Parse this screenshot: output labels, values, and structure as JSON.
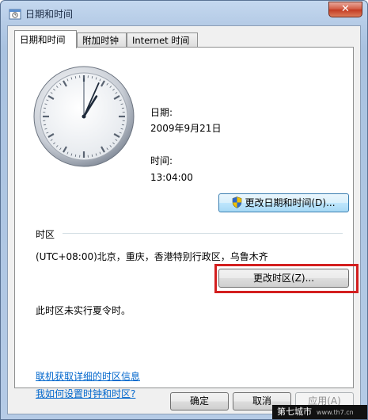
{
  "window": {
    "title": "日期和时间",
    "close_label": "✕"
  },
  "tabs": [
    {
      "label": "日期和时间",
      "active": true
    },
    {
      "label": "附加时钟",
      "active": false
    },
    {
      "label": "Internet 时间",
      "active": false
    }
  ],
  "clock": {
    "hour": 13,
    "minute": 4,
    "second": 0
  },
  "date": {
    "label": "日期:",
    "value": "2009年9月21日"
  },
  "time": {
    "label": "时间:",
    "value": "13:04:00"
  },
  "change_datetime_button": "更改日期和时间(D)...",
  "timezone": {
    "section_title": "时区",
    "value": "(UTC+08:00)北京，重庆，香港特别行政区，乌鲁木齐",
    "change_button": "更改时区(Z)...",
    "dst_note": "此时区未实行夏令时。"
  },
  "links": {
    "online_info": "联机获取详细的时区信息",
    "how_to": "我如何设置时钟和时区?"
  },
  "footer": {
    "ok": "确定",
    "cancel": "取消",
    "apply": "应用(A)"
  },
  "watermark": {
    "text": "第七城市",
    "url": "www.th7.cn"
  },
  "colors": {
    "highlight": "#d31f1f",
    "link": "#0066cc"
  }
}
